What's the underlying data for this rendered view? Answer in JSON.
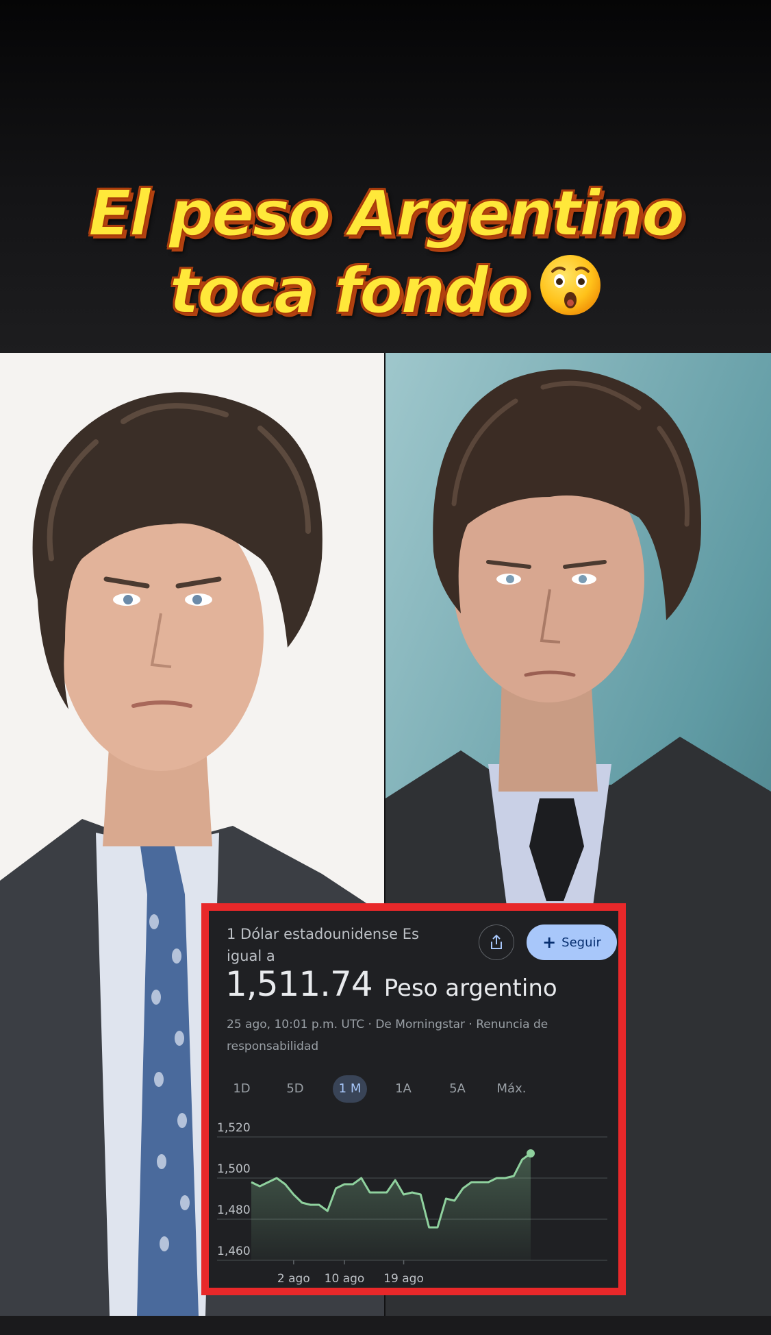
{
  "headline": {
    "line1": "El peso Argentino",
    "line2": "toca fondo",
    "emoji": "astonished-face"
  },
  "photos": {
    "left": "man-in-suit-portrait",
    "right": "man-in-suit-portrait"
  },
  "card": {
    "title": "1 Dólar estadounidense Es igual a",
    "share_icon": "share-icon",
    "follow_label": "Seguir",
    "follow_icon": "plus-icon",
    "rate_value": "1,511.74",
    "rate_currency": "Peso argentino",
    "meta": "25 ago, 10:01 p.m. UTC · De Morningstar · Renuncia de responsabilidad",
    "tabs": [
      {
        "label": "1D",
        "active": false
      },
      {
        "label": "5D",
        "active": false
      },
      {
        "label": "1 M",
        "active": true
      },
      {
        "label": "1A",
        "active": false
      },
      {
        "label": "5A",
        "active": false
      },
      {
        "label": "Máx.",
        "active": false
      }
    ],
    "colors": {
      "border": "#e8282a",
      "background": "#1f2023",
      "line": "#8fd19e",
      "follow_bg": "#a8c7fa"
    }
  },
  "chart_data": {
    "type": "area",
    "title": "",
    "xlabel": "",
    "ylabel": "",
    "ylim": [
      1460,
      1520
    ],
    "yticks": [
      1520,
      1500,
      1480,
      1460
    ],
    "ytick_labels": [
      "1,520",
      "1,500",
      "1,480",
      "1,460"
    ],
    "xticks": [
      {
        "label": "2 ago",
        "index": 5
      },
      {
        "label": "10 ago",
        "index": 11
      },
      {
        "label": "19 ago",
        "index": 18
      }
    ],
    "grid": true,
    "series": [
      {
        "values": [
          1498,
          1496,
          1498,
          1500,
          1497,
          1492,
          1488,
          1487,
          1487,
          1484,
          1495,
          1497,
          1497,
          1500,
          1493,
          1493,
          1493,
          1499,
          1492,
          1493,
          1492,
          1476,
          1476,
          1490,
          1489,
          1495,
          1498,
          1498,
          1498,
          1500,
          1500,
          1501,
          1509,
          1512
        ]
      }
    ]
  }
}
